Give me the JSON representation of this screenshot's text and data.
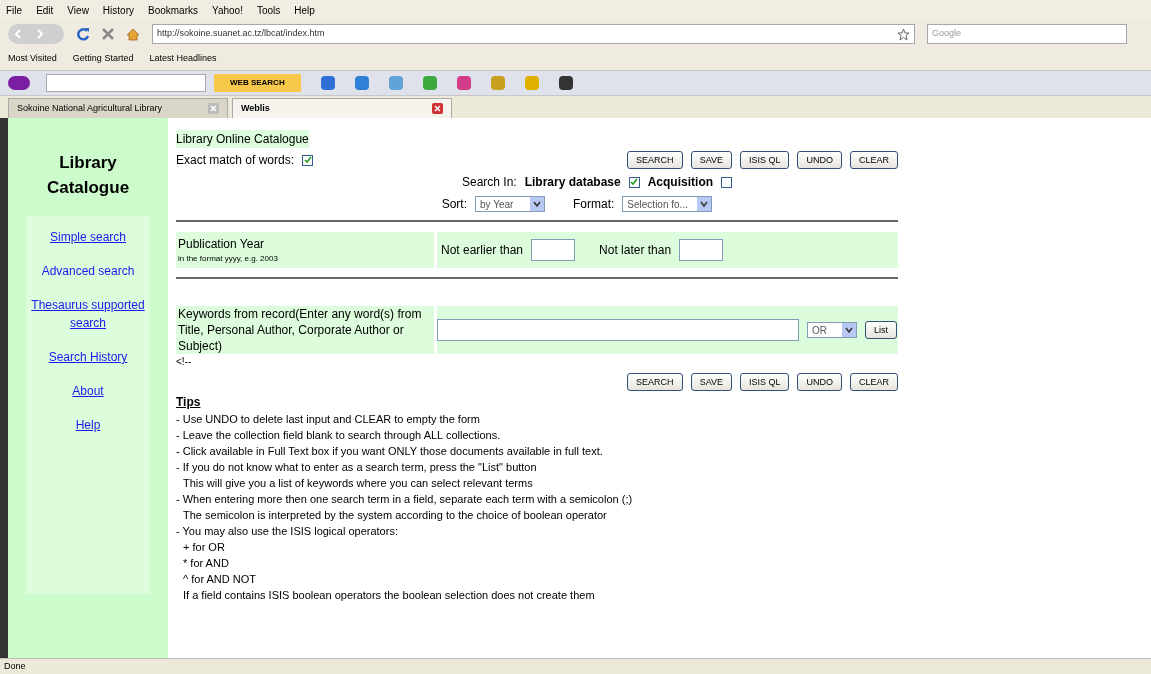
{
  "menu": [
    "File",
    "Edit",
    "View",
    "History",
    "Bookmarks",
    "Yahoo!",
    "Tools",
    "Help"
  ],
  "nav": {
    "url": "http://sokoine.suanet.ac.tz/lbcat/index.htm",
    "search_placeholder": "Google"
  },
  "bookmarks": [
    "Most Visited",
    "Getting Started",
    "Latest Headlines"
  ],
  "yahoo": {
    "search_button": "WEB SEARCH"
  },
  "tabs": [
    {
      "label": "Sokoine National Agricultural Library",
      "selected": false
    },
    {
      "label": "Weblis",
      "selected": true
    }
  ],
  "sidebar": {
    "title": "Library Catalogue",
    "links": [
      {
        "label": "Simple search",
        "selected": false
      },
      {
        "label": "Advanced search",
        "selected": true
      },
      {
        "label": "Thesaurus supported search",
        "selected": false
      },
      {
        "label": "Search History",
        "selected": false
      },
      {
        "label": "About",
        "selected": false
      },
      {
        "label": "Help",
        "selected": false
      }
    ]
  },
  "form": {
    "heading": "Library Online Catalogue",
    "exact_match": {
      "label": "Exact match of words:",
      "checked": true
    },
    "buttons": [
      "SEARCH",
      "SAVE",
      "ISIS QL",
      "UNDO",
      "CLEAR"
    ],
    "search_in": {
      "label": "Search In:",
      "options": [
        {
          "label": "Library database",
          "checked": true
        },
        {
          "label": "Acquisition",
          "checked": false
        }
      ]
    },
    "sort": {
      "label": "Sort:",
      "value": "by Year"
    },
    "format": {
      "label": "Format:",
      "value": "Selection fo..."
    },
    "publication": {
      "label": "Publication Year",
      "hint": "in the format yyyy, e.g. 2003",
      "from_label": "Not earlier than",
      "to_label": "Not later than"
    },
    "keywords": {
      "label": "Keywords from record(Enter any word(s) from Title, Personal Author, Corporate Author or Subject)",
      "operator": "OR",
      "list_button": "List"
    },
    "comment": "<!--",
    "bottom_buttons": [
      "SEARCH",
      "SAVE",
      "ISIS QL",
      "UNDO",
      "CLEAR"
    ]
  },
  "tips": {
    "title": "Tips",
    "lines": [
      {
        "kind": "bullet",
        "text": "- Use UNDO to delete last input and CLEAR to empty the form"
      },
      {
        "kind": "bullet",
        "text": "- Leave the collection field blank to search through ALL collections."
      },
      {
        "kind": "bullet",
        "text": "- Click available in Full Text box if you want ONLY those documents available in full text."
      },
      {
        "kind": "bullet",
        "text": "- If you do not know what to enter as a search term, press the \"List\" button"
      },
      {
        "kind": "cont",
        "text": "This will give you a list of keywords where you can select relevant terms"
      },
      {
        "kind": "bullet",
        "text": "- When entering more then one search term in a field, separate each term with a semicolon (;)"
      },
      {
        "kind": "cont",
        "text": "The semicolon is interpreted by the system according to the choice of boolean operator"
      },
      {
        "kind": "bullet",
        "text": "- You may also use the ISIS logical operators:"
      },
      {
        "kind": "cont",
        "text": "+ for OR"
      },
      {
        "kind": "cont",
        "text": "* for AND"
      },
      {
        "kind": "cont",
        "text": "^ for AND NOT"
      },
      {
        "kind": "cont",
        "text": "If a field contains ISIS boolean operators the boolean selection does not create them"
      }
    ]
  },
  "status": "Done"
}
